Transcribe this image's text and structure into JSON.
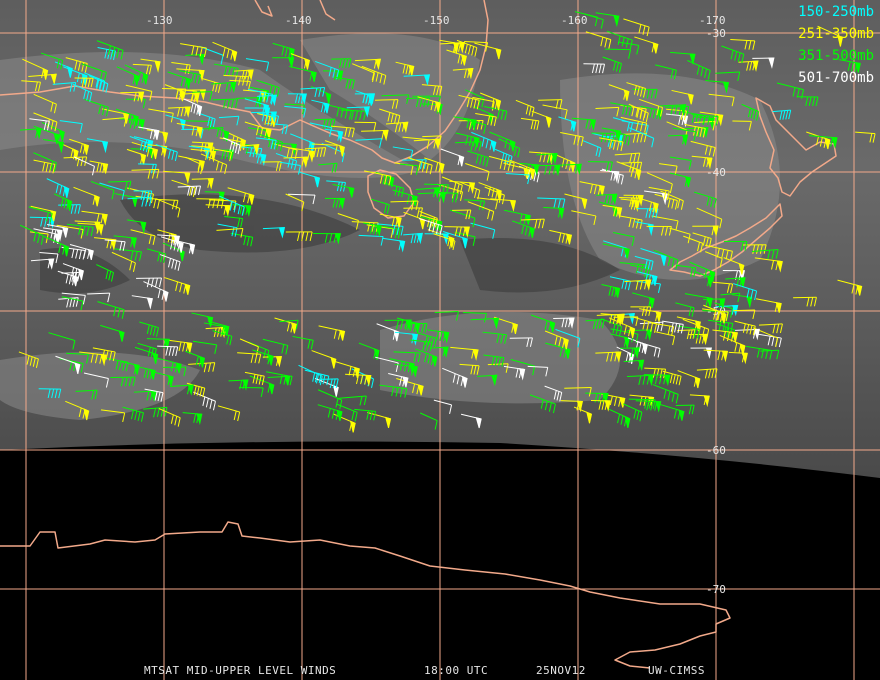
{
  "legend": [
    {
      "label": "150-250mb",
      "color": "#00ffff"
    },
    {
      "label": "251-350mb",
      "color": "#ffff00"
    },
    {
      "label": "351-500mb",
      "color": "#00ff00"
    },
    {
      "label": "501-700mb",
      "color": "#ffffff"
    }
  ],
  "longitude_labels": [
    "-130",
    "-140",
    "-150",
    "-160",
    "-170"
  ],
  "latitude_labels": [
    "-30",
    "-40",
    "-50",
    "-60",
    "-70"
  ],
  "footer": {
    "product": "MTSAT MID-UPPER LEVEL WINDS",
    "time": "18:00 UTC",
    "date": "25NOV12",
    "source": "UW-CIMSS"
  },
  "colors": {
    "grid": "#f2a98a",
    "coast": "#f2a98a",
    "background": "#000000"
  },
  "icons": [
    "wind-barb-icon"
  ]
}
